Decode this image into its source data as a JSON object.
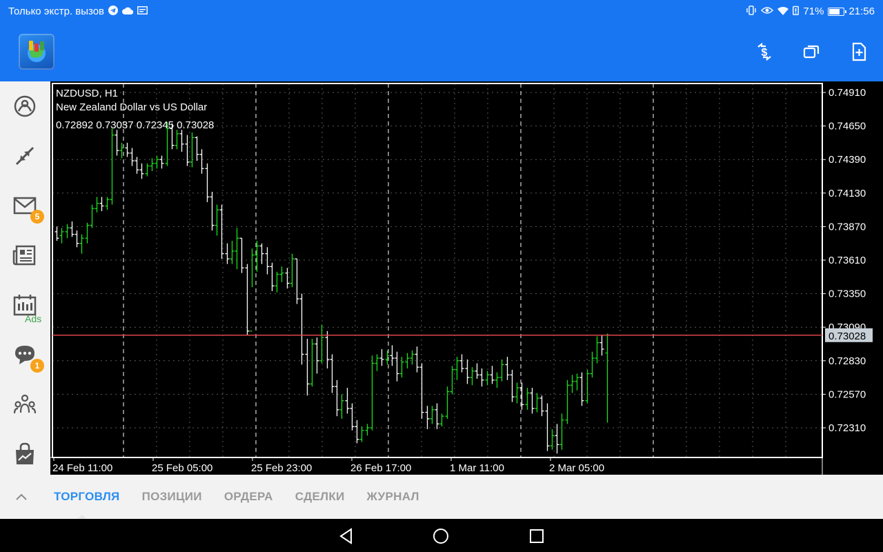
{
  "status_bar": {
    "left_text": "Только экстр. вызов",
    "battery_percent": 71,
    "battery_label": "71%",
    "time": "21:56",
    "left_icons": [
      "telegram-icon",
      "cloud-icon",
      "card-icon"
    ],
    "right_icons": [
      "vibrate-icon",
      "eye-icon",
      "wifi-icon",
      "battery-alert-icon",
      "battery-icon"
    ]
  },
  "app_bar": {
    "logo": "metatrader-logo",
    "actions": [
      "dollar-exchange-icon",
      "windows-icon",
      "add-document-icon"
    ]
  },
  "sidebar": {
    "items": [
      {
        "name": "quotes",
        "icon": "quotes-icon"
      },
      {
        "name": "trade",
        "icon": "trade-arrows-icon"
      },
      {
        "name": "mail",
        "icon": "mail-icon",
        "badge": "5"
      },
      {
        "name": "news",
        "icon": "news-icon"
      },
      {
        "name": "calendar",
        "icon": "calendar-icon",
        "label": "Ads"
      },
      {
        "name": "chat",
        "icon": "chat-icon",
        "badge": "1"
      },
      {
        "name": "community",
        "icon": "community-icon"
      },
      {
        "name": "market",
        "icon": "market-bag-icon"
      }
    ]
  },
  "chart": {
    "symbol": "NZDUSD, H1",
    "description": "New Zealand Dollar vs US Dollar",
    "ohlc": "0.72892 0.73037 0.72345 0.73028",
    "current_price": "0.73028",
    "colors": {
      "bull": "#19e319",
      "bear": "#ffffff",
      "price_line": "#e0454a",
      "grid": "#5a5a5a",
      "background": "#000000"
    }
  },
  "chart_data": {
    "type": "ohlc_bars",
    "y_ticks": [
      "0.74910",
      "0.74650",
      "0.74390",
      "0.74130",
      "0.73870",
      "0.73610",
      "0.73350",
      "0.73090",
      "0.72830",
      "0.72570",
      "0.72310"
    ],
    "x_ticks": [
      "24 Feb 11:00",
      "25 Feb 05:00",
      "25 Feb 23:00",
      "26 Feb 17:00",
      "1 Mar 11:00",
      "2 Mar 05:00"
    ],
    "ylim": [
      0.7212,
      0.7506
    ],
    "current_price": 0.73028,
    "bars": [
      [
        0.7383,
        0.7387,
        0.7376,
        0.7378
      ],
      [
        0.738,
        0.7386,
        0.7374,
        0.7383
      ],
      [
        0.7383,
        0.7389,
        0.7378,
        0.7386
      ],
      [
        0.7386,
        0.7391,
        0.7379,
        0.7381
      ],
      [
        0.7381,
        0.7384,
        0.7371,
        0.7374
      ],
      [
        0.7374,
        0.7381,
        0.7366,
        0.7378
      ],
      [
        0.7378,
        0.739,
        0.7374,
        0.7388
      ],
      [
        0.7388,
        0.7404,
        0.7386,
        0.7401
      ],
      [
        0.7401,
        0.741,
        0.7398,
        0.7405
      ],
      [
        0.7405,
        0.741,
        0.7399,
        0.7403
      ],
      [
        0.7403,
        0.741,
        0.74,
        0.7408
      ],
      [
        0.7408,
        0.7463,
        0.7404,
        0.7458
      ],
      [
        0.7458,
        0.7462,
        0.7442,
        0.7446
      ],
      [
        0.7446,
        0.7452,
        0.744,
        0.7448
      ],
      [
        0.7448,
        0.7452,
        0.7441,
        0.7444
      ],
      [
        0.7444,
        0.7448,
        0.7434,
        0.7438
      ],
      [
        0.7438,
        0.7441,
        0.7428,
        0.7431
      ],
      [
        0.7431,
        0.7436,
        0.7424,
        0.7428
      ],
      [
        0.7428,
        0.7436,
        0.7426,
        0.7434
      ],
      [
        0.7434,
        0.744,
        0.743,
        0.7436
      ],
      [
        0.7436,
        0.7442,
        0.7432,
        0.7439
      ],
      [
        0.7439,
        0.7442,
        0.7432,
        0.7436
      ],
      [
        0.7436,
        0.7468,
        0.7434,
        0.7463
      ],
      [
        0.7463,
        0.7467,
        0.7447,
        0.745
      ],
      [
        0.745,
        0.7462,
        0.7447,
        0.7459
      ],
      [
        0.7459,
        0.7462,
        0.7445,
        0.7451
      ],
      [
        0.7451,
        0.7458,
        0.7434,
        0.7437
      ],
      [
        0.7437,
        0.746,
        0.7433,
        0.7456
      ],
      [
        0.7456,
        0.7457,
        0.7438,
        0.7443
      ],
      [
        0.7443,
        0.7447,
        0.7428,
        0.7432
      ],
      [
        0.7432,
        0.7436,
        0.7406,
        0.741
      ],
      [
        0.741,
        0.7414,
        0.7384,
        0.7388
      ],
      [
        0.7388,
        0.7404,
        0.738,
        0.74
      ],
      [
        0.74,
        0.7404,
        0.7362,
        0.7366
      ],
      [
        0.7366,
        0.7374,
        0.7358,
        0.7362
      ],
      [
        0.7362,
        0.7376,
        0.7358,
        0.7368
      ],
      [
        0.7368,
        0.7386,
        0.7354,
        0.7378
      ],
      [
        0.7378,
        0.7378,
        0.7351,
        0.7355
      ],
      [
        0.7355,
        0.7358,
        0.7303,
        0.7306
      ],
      [
        0.7306,
        0.737,
        0.734,
        0.7365
      ],
      [
        0.7365,
        0.7376,
        0.7352,
        0.7372
      ],
      [
        0.7372,
        0.7374,
        0.7358,
        0.7366
      ],
      [
        0.7366,
        0.7371,
        0.735,
        0.7356
      ],
      [
        0.7356,
        0.7359,
        0.7337,
        0.7341
      ],
      [
        0.7341,
        0.7352,
        0.7336,
        0.735
      ],
      [
        0.735,
        0.7356,
        0.7344,
        0.7351
      ],
      [
        0.7351,
        0.7355,
        0.7339,
        0.7343
      ],
      [
        0.7343,
        0.7366,
        0.734,
        0.7362
      ],
      [
        0.7362,
        0.7362,
        0.7327,
        0.7331
      ],
      [
        0.7331,
        0.7335,
        0.728,
        0.7288
      ],
      [
        0.7288,
        0.73,
        0.7256,
        0.7265
      ],
      [
        0.7265,
        0.73,
        0.7263,
        0.7296
      ],
      [
        0.7296,
        0.7301,
        0.7273,
        0.7283
      ],
      [
        0.7283,
        0.7311,
        0.7281,
        0.7301
      ],
      [
        0.7301,
        0.7306,
        0.7277,
        0.7284
      ],
      [
        0.7284,
        0.7288,
        0.7258,
        0.7263
      ],
      [
        0.7263,
        0.7268,
        0.724,
        0.7245
      ],
      [
        0.7245,
        0.7257,
        0.7238,
        0.7252
      ],
      [
        0.7252,
        0.7262,
        0.7242,
        0.7246
      ],
      [
        0.7246,
        0.725,
        0.7229,
        0.7232
      ],
      [
        0.7232,
        0.7237,
        0.7219,
        0.7222
      ],
      [
        0.7222,
        0.7232,
        0.722,
        0.7229
      ],
      [
        0.7229,
        0.7234,
        0.7225,
        0.7231
      ],
      [
        0.7231,
        0.7287,
        0.7229,
        0.7281
      ],
      [
        0.7281,
        0.7288,
        0.7275,
        0.7285
      ],
      [
        0.7285,
        0.7292,
        0.7279,
        0.7284
      ],
      [
        0.7284,
        0.7291,
        0.728,
        0.7287
      ],
      [
        0.7287,
        0.7295,
        0.7279,
        0.7285
      ],
      [
        0.7285,
        0.729,
        0.7267,
        0.7273
      ],
      [
        0.7273,
        0.7286,
        0.727,
        0.7282
      ],
      [
        0.7282,
        0.7289,
        0.7277,
        0.7285
      ],
      [
        0.7285,
        0.7291,
        0.728,
        0.7288
      ],
      [
        0.7288,
        0.7294,
        0.7274,
        0.7278
      ],
      [
        0.7278,
        0.7281,
        0.7238,
        0.7243
      ],
      [
        0.7243,
        0.7248,
        0.723,
        0.7238
      ],
      [
        0.7238,
        0.7248,
        0.7234,
        0.7245
      ],
      [
        0.7245,
        0.725,
        0.723,
        0.7234
      ],
      [
        0.7234,
        0.7242,
        0.7232,
        0.724
      ],
      [
        0.724,
        0.7263,
        0.7238,
        0.7259
      ],
      [
        0.7259,
        0.7279,
        0.7257,
        0.7276
      ],
      [
        0.7276,
        0.7286,
        0.7268,
        0.7283
      ],
      [
        0.7283,
        0.7288,
        0.7274,
        0.7277
      ],
      [
        0.7277,
        0.7284,
        0.7265,
        0.727
      ],
      [
        0.727,
        0.7278,
        0.7264,
        0.7275
      ],
      [
        0.7275,
        0.7281,
        0.7269,
        0.7272
      ],
      [
        0.7272,
        0.7277,
        0.7263,
        0.7268
      ],
      [
        0.7268,
        0.7275,
        0.7264,
        0.7272
      ],
      [
        0.7272,
        0.7279,
        0.7265,
        0.7268
      ],
      [
        0.7268,
        0.7274,
        0.7262,
        0.727
      ],
      [
        0.727,
        0.7284,
        0.7267,
        0.728
      ],
      [
        0.728,
        0.7286,
        0.7268,
        0.7272
      ],
      [
        0.7272,
        0.7276,
        0.7251,
        0.7255
      ],
      [
        0.7255,
        0.7266,
        0.725,
        0.7262
      ],
      [
        0.7262,
        0.7266,
        0.7245,
        0.7249
      ],
      [
        0.7249,
        0.7262,
        0.7245,
        0.7258
      ],
      [
        0.7258,
        0.7262,
        0.7242,
        0.7246
      ],
      [
        0.7246,
        0.7258,
        0.7243,
        0.7254
      ],
      [
        0.7254,
        0.7256,
        0.724,
        0.7244
      ],
      [
        0.7244,
        0.725,
        0.7213,
        0.7217
      ],
      [
        0.7217,
        0.723,
        0.7214,
        0.7225
      ],
      [
        0.7225,
        0.7234,
        0.7211,
        0.7218
      ],
      [
        0.7218,
        0.7242,
        0.7214,
        0.7237
      ],
      [
        0.7237,
        0.7268,
        0.7234,
        0.7264
      ],
      [
        0.7264,
        0.7272,
        0.7258,
        0.7267
      ],
      [
        0.7267,
        0.7273,
        0.726,
        0.727
      ],
      [
        0.727,
        0.7274,
        0.7248,
        0.7252
      ],
      [
        0.7252,
        0.7276,
        0.725,
        0.7273
      ],
      [
        0.7273,
        0.729,
        0.727,
        0.7285
      ],
      [
        0.7285,
        0.7302,
        0.7281,
        0.7297
      ],
      [
        0.7297,
        0.7303,
        0.7287,
        0.7292
      ],
      [
        0.7289,
        0.7304,
        0.7235,
        0.7303
      ]
    ]
  },
  "tabs": {
    "items": [
      "ТОРГОВЛЯ",
      "ПОЗИЦИИ",
      "ОРДЕРА",
      "СДЕЛКИ",
      "ЖУРНАЛ"
    ],
    "active": "ТОРГОВЛЯ"
  },
  "nav_bar": {
    "buttons": [
      "back-icon",
      "home-icon",
      "recents-icon"
    ]
  }
}
